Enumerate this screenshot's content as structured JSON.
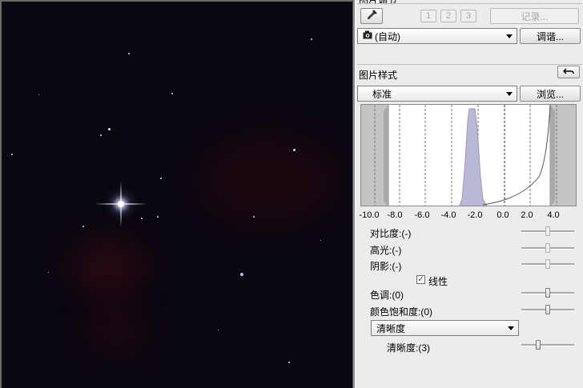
{
  "canvas": {
    "name": "starfield-preview"
  },
  "panel": {
    "top_title": "图片调节",
    "top_buttons": {
      "eyedropper_icon": "eyedropper-icon",
      "slot1": "1",
      "slot2": "2",
      "slot3": "3",
      "record": "记录..."
    },
    "white_balance": {
      "camera_icon": "camera-icon",
      "value": "(自动)",
      "adjust_button": "调谐..."
    },
    "picture_style": {
      "title": "图片样式",
      "reset_icon": "undo-arrow-icon",
      "style_value": "标准",
      "browse_button": "浏览...",
      "histogram_ticks": [
        "-10.0",
        "-8.0",
        "-6.0",
        "-4.0",
        "-2.0",
        "0.0",
        "2.0",
        "4.0"
      ],
      "contrast": "对比度:(-)",
      "highlight": "高光:(-)",
      "shadow": "阴影:(-)",
      "linear_label": "线性",
      "linear_checked": true,
      "hue": "色调:(0)",
      "saturation": "颜色饱和度:(0)",
      "sharpness_mode": "清晰度",
      "sharpness": "清晰度:(3)"
    }
  },
  "colors": {
    "panel_bg": "#ececec",
    "canvas_bg": "#0b0710",
    "histogram_fill": "#b9b9d6"
  }
}
